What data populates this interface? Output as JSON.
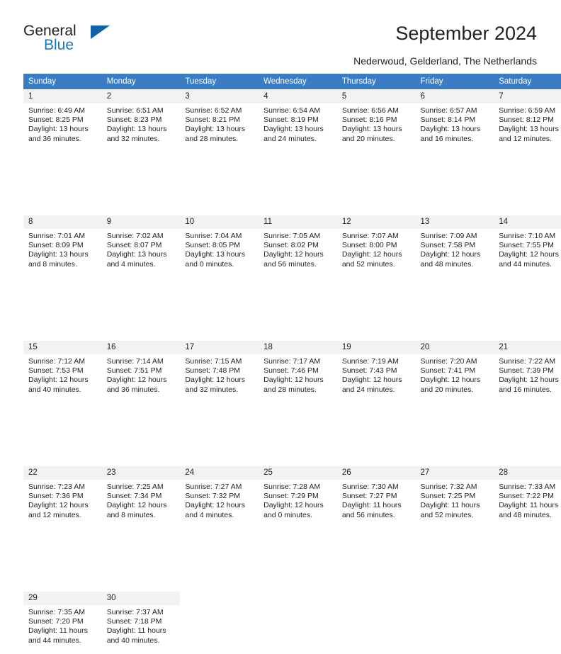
{
  "brand": {
    "line1": "General",
    "line2": "Blue",
    "triangle_color": "#1062a8",
    "blue_text_color": "#1878be"
  },
  "header": {
    "title": "September 2024",
    "subtitle": "Nederwoud, Gelderland, The Netherlands"
  },
  "theme": {
    "header_row_bg": "#3b7dc4",
    "header_row_text": "#ffffff",
    "daynum_bg": "#f2f2f2",
    "cell_bg": "#ffffff",
    "separator": "#d9d9d9"
  },
  "calendar": {
    "weekday_headers": [
      "Sunday",
      "Monday",
      "Tuesday",
      "Wednesday",
      "Thursday",
      "Friday",
      "Saturday"
    ],
    "weeks": [
      [
        {
          "day": "1",
          "sunrise": "Sunrise: 6:49 AM",
          "sunset": "Sunset: 8:25 PM",
          "daylight1": "Daylight: 13 hours",
          "daylight2": "and 36 minutes."
        },
        {
          "day": "2",
          "sunrise": "Sunrise: 6:51 AM",
          "sunset": "Sunset: 8:23 PM",
          "daylight1": "Daylight: 13 hours",
          "daylight2": "and 32 minutes."
        },
        {
          "day": "3",
          "sunrise": "Sunrise: 6:52 AM",
          "sunset": "Sunset: 8:21 PM",
          "daylight1": "Daylight: 13 hours",
          "daylight2": "and 28 minutes."
        },
        {
          "day": "4",
          "sunrise": "Sunrise: 6:54 AM",
          "sunset": "Sunset: 8:19 PM",
          "daylight1": "Daylight: 13 hours",
          "daylight2": "and 24 minutes."
        },
        {
          "day": "5",
          "sunrise": "Sunrise: 6:56 AM",
          "sunset": "Sunset: 8:16 PM",
          "daylight1": "Daylight: 13 hours",
          "daylight2": "and 20 minutes."
        },
        {
          "day": "6",
          "sunrise": "Sunrise: 6:57 AM",
          "sunset": "Sunset: 8:14 PM",
          "daylight1": "Daylight: 13 hours",
          "daylight2": "and 16 minutes."
        },
        {
          "day": "7",
          "sunrise": "Sunrise: 6:59 AM",
          "sunset": "Sunset: 8:12 PM",
          "daylight1": "Daylight: 13 hours",
          "daylight2": "and 12 minutes."
        }
      ],
      [
        {
          "day": "8",
          "sunrise": "Sunrise: 7:01 AM",
          "sunset": "Sunset: 8:09 PM",
          "daylight1": "Daylight: 13 hours",
          "daylight2": "and 8 minutes."
        },
        {
          "day": "9",
          "sunrise": "Sunrise: 7:02 AM",
          "sunset": "Sunset: 8:07 PM",
          "daylight1": "Daylight: 13 hours",
          "daylight2": "and 4 minutes."
        },
        {
          "day": "10",
          "sunrise": "Sunrise: 7:04 AM",
          "sunset": "Sunset: 8:05 PM",
          "daylight1": "Daylight: 13 hours",
          "daylight2": "and 0 minutes."
        },
        {
          "day": "11",
          "sunrise": "Sunrise: 7:05 AM",
          "sunset": "Sunset: 8:02 PM",
          "daylight1": "Daylight: 12 hours",
          "daylight2": "and 56 minutes."
        },
        {
          "day": "12",
          "sunrise": "Sunrise: 7:07 AM",
          "sunset": "Sunset: 8:00 PM",
          "daylight1": "Daylight: 12 hours",
          "daylight2": "and 52 minutes."
        },
        {
          "day": "13",
          "sunrise": "Sunrise: 7:09 AM",
          "sunset": "Sunset: 7:58 PM",
          "daylight1": "Daylight: 12 hours",
          "daylight2": "and 48 minutes."
        },
        {
          "day": "14",
          "sunrise": "Sunrise: 7:10 AM",
          "sunset": "Sunset: 7:55 PM",
          "daylight1": "Daylight: 12 hours",
          "daylight2": "and 44 minutes."
        }
      ],
      [
        {
          "day": "15",
          "sunrise": "Sunrise: 7:12 AM",
          "sunset": "Sunset: 7:53 PM",
          "daylight1": "Daylight: 12 hours",
          "daylight2": "and 40 minutes."
        },
        {
          "day": "16",
          "sunrise": "Sunrise: 7:14 AM",
          "sunset": "Sunset: 7:51 PM",
          "daylight1": "Daylight: 12 hours",
          "daylight2": "and 36 minutes."
        },
        {
          "day": "17",
          "sunrise": "Sunrise: 7:15 AM",
          "sunset": "Sunset: 7:48 PM",
          "daylight1": "Daylight: 12 hours",
          "daylight2": "and 32 minutes."
        },
        {
          "day": "18",
          "sunrise": "Sunrise: 7:17 AM",
          "sunset": "Sunset: 7:46 PM",
          "daylight1": "Daylight: 12 hours",
          "daylight2": "and 28 minutes."
        },
        {
          "day": "19",
          "sunrise": "Sunrise: 7:19 AM",
          "sunset": "Sunset: 7:43 PM",
          "daylight1": "Daylight: 12 hours",
          "daylight2": "and 24 minutes."
        },
        {
          "day": "20",
          "sunrise": "Sunrise: 7:20 AM",
          "sunset": "Sunset: 7:41 PM",
          "daylight1": "Daylight: 12 hours",
          "daylight2": "and 20 minutes."
        },
        {
          "day": "21",
          "sunrise": "Sunrise: 7:22 AM",
          "sunset": "Sunset: 7:39 PM",
          "daylight1": "Daylight: 12 hours",
          "daylight2": "and 16 minutes."
        }
      ],
      [
        {
          "day": "22",
          "sunrise": "Sunrise: 7:23 AM",
          "sunset": "Sunset: 7:36 PM",
          "daylight1": "Daylight: 12 hours",
          "daylight2": "and 12 minutes."
        },
        {
          "day": "23",
          "sunrise": "Sunrise: 7:25 AM",
          "sunset": "Sunset: 7:34 PM",
          "daylight1": "Daylight: 12 hours",
          "daylight2": "and 8 minutes."
        },
        {
          "day": "24",
          "sunrise": "Sunrise: 7:27 AM",
          "sunset": "Sunset: 7:32 PM",
          "daylight1": "Daylight: 12 hours",
          "daylight2": "and 4 minutes."
        },
        {
          "day": "25",
          "sunrise": "Sunrise: 7:28 AM",
          "sunset": "Sunset: 7:29 PM",
          "daylight1": "Daylight: 12 hours",
          "daylight2": "and 0 minutes."
        },
        {
          "day": "26",
          "sunrise": "Sunrise: 7:30 AM",
          "sunset": "Sunset: 7:27 PM",
          "daylight1": "Daylight: 11 hours",
          "daylight2": "and 56 minutes."
        },
        {
          "day": "27",
          "sunrise": "Sunrise: 7:32 AM",
          "sunset": "Sunset: 7:25 PM",
          "daylight1": "Daylight: 11 hours",
          "daylight2": "and 52 minutes."
        },
        {
          "day": "28",
          "sunrise": "Sunrise: 7:33 AM",
          "sunset": "Sunset: 7:22 PM",
          "daylight1": "Daylight: 11 hours",
          "daylight2": "and 48 minutes."
        }
      ],
      [
        {
          "day": "29",
          "sunrise": "Sunrise: 7:35 AM",
          "sunset": "Sunset: 7:20 PM",
          "daylight1": "Daylight: 11 hours",
          "daylight2": "and 44 minutes."
        },
        {
          "day": "30",
          "sunrise": "Sunrise: 7:37 AM",
          "sunset": "Sunset: 7:18 PM",
          "daylight1": "Daylight: 11 hours",
          "daylight2": "and 40 minutes."
        },
        {
          "day": "",
          "sunrise": "",
          "sunset": "",
          "daylight1": "",
          "daylight2": ""
        },
        {
          "day": "",
          "sunrise": "",
          "sunset": "",
          "daylight1": "",
          "daylight2": ""
        },
        {
          "day": "",
          "sunrise": "",
          "sunset": "",
          "daylight1": "",
          "daylight2": ""
        },
        {
          "day": "",
          "sunrise": "",
          "sunset": "",
          "daylight1": "",
          "daylight2": ""
        },
        {
          "day": "",
          "sunrise": "",
          "sunset": "",
          "daylight1": "",
          "daylight2": ""
        }
      ]
    ]
  }
}
